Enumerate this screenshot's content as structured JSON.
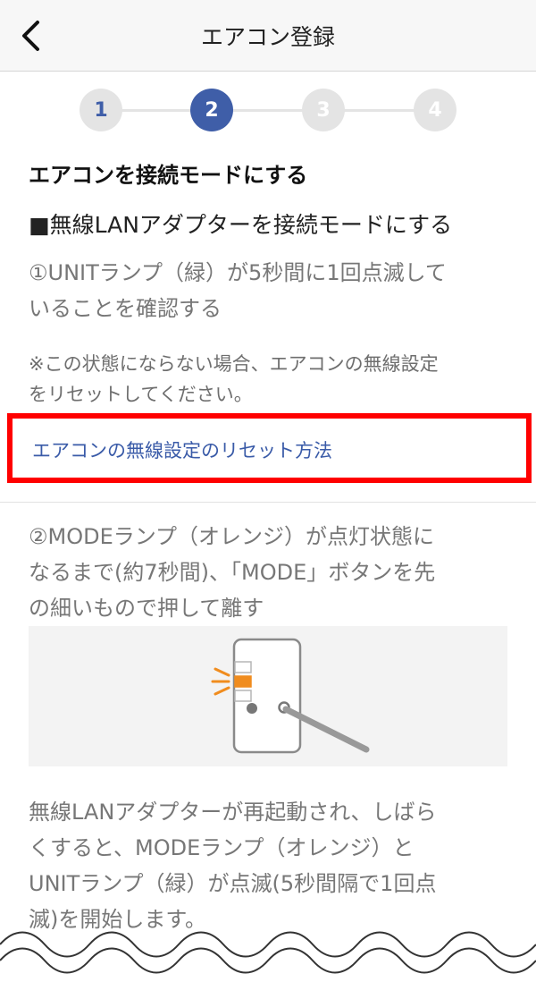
{
  "header": {
    "title": "エアコン登録",
    "back_icon": "chevron-left-icon"
  },
  "stepper": {
    "steps": [
      "1",
      "2",
      "3",
      "4"
    ],
    "current": 2,
    "active_color": "#3f5ea8",
    "inactive_color": "#e4e4e4"
  },
  "content": {
    "section_title": "エアコンを接続モードにする",
    "subtitle": "■無線LANアダプターを接続モードにする",
    "step1_line1": "①UNITランプ（緑）が5秒間に1回点滅して",
    "step1_line2": "いることを確認する",
    "note_line1": "※この状態にならない場合、エアコンの無線設定",
    "note_line2": "をリセットしてください。",
    "reset_link": "エアコンの無線設定のリセット方法",
    "step2_line1": "②MODEランプ（オレンジ）が点灯状態に",
    "step2_line2": "なるまで(約7秒間)、「MODE」ボタンを先",
    "step2_line3": "の細いもので押して離す",
    "result_line1": "無線LANアダプターが再起動され、しばら",
    "result_line2": "くすると、MODEランプ（オレンジ）と",
    "result_line3": "UNITランプ（緑）が点滅(5秒間隔で1回点",
    "result_line4": "滅)を開始します。"
  },
  "colors": {
    "link": "#3a5ba8",
    "highlight_border": "#ff0000",
    "mode_lamp": "#f08c1e"
  },
  "illustration": {
    "icon": "adapter-mode-button-illustration"
  }
}
